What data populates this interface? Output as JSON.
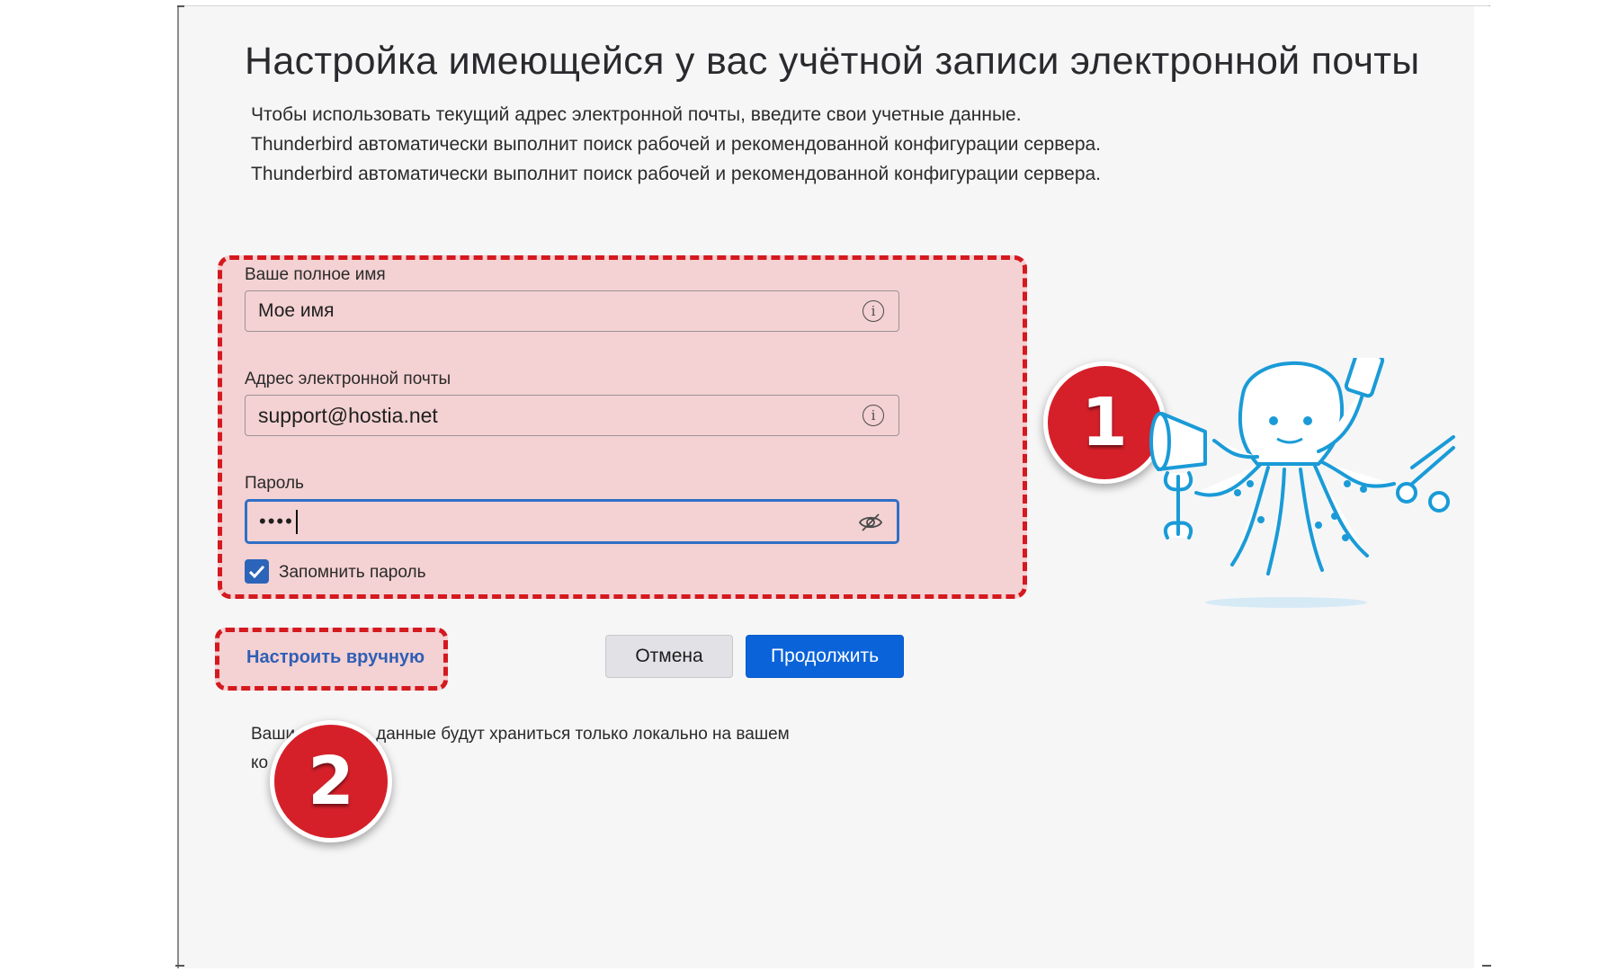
{
  "dialog": {
    "title": "Настройка имеющейся у вас учётной записи электронной почты",
    "description": [
      "Чтобы использовать текущий адрес электронной почты, введите свои учетные данные.",
      "Thunderbird автоматически выполнит поиск рабочей и рекомендованной конфигурации сервера.",
      "Thunderbird автоматически выполнит поиск рабочей и рекомендованной конфигурации сервера."
    ]
  },
  "form": {
    "name": {
      "label": "Ваше полное имя",
      "value": "Мое имя"
    },
    "email": {
      "label": "Адрес электронной почты",
      "value": "support@hostia.net"
    },
    "password": {
      "label": "Пароль",
      "value": "••••"
    },
    "remember": {
      "label": "Запомнить пароль",
      "checked": true
    }
  },
  "actions": {
    "manual": "Настроить вручную",
    "cancel": "Отмена",
    "continue": "Продолжить"
  },
  "footer": {
    "line1_start": "Ваши",
    "line1_end": "данные будут храниться только локально на вашем",
    "line2_start": "ко"
  },
  "annotations": {
    "badge1": "1",
    "badge2": "2"
  },
  "colors": {
    "accent": "#0a63d9",
    "highlight_border": "#d4191f",
    "badge": "#d5202a",
    "mascot": "#1a9bd7"
  },
  "icons": [
    "info-icon",
    "eye-slash-icon",
    "checkmark-icon",
    "octopus-mascot"
  ]
}
